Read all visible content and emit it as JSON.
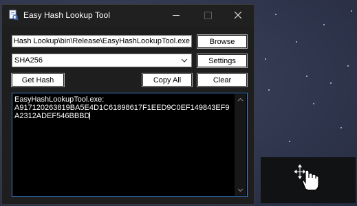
{
  "window": {
    "title": "Easy Hash Lookup Tool",
    "controls": {
      "minimize": "minimize",
      "maximize": "maximize",
      "close": "close"
    }
  },
  "form": {
    "path_value": "Hash Lookup\\bin\\Release\\EasyHashLookupTool.exe",
    "algorithm": "SHA256",
    "browse_label": "Browse",
    "settings_label": "Settings",
    "get_hash_label": "Get Hash",
    "copy_all_label": "Copy All",
    "clear_label": "Clear"
  },
  "output": {
    "text": "EasyHashLookupTool.exe:\nA917120263819BA5E4D1C61898617F1EED9C0EF149843EF9A2312ADEF546BBBD"
  },
  "colors": {
    "window_bg": "#1e1e1e",
    "titlebar_bg": "#202020",
    "output_border": "#3c7fd4",
    "desktop_bg": "#333a52"
  },
  "icons": {
    "app": "app-hash-icon",
    "dropdown": "chevron-down-icon",
    "cursor": "move-hand-cursor-icon"
  }
}
